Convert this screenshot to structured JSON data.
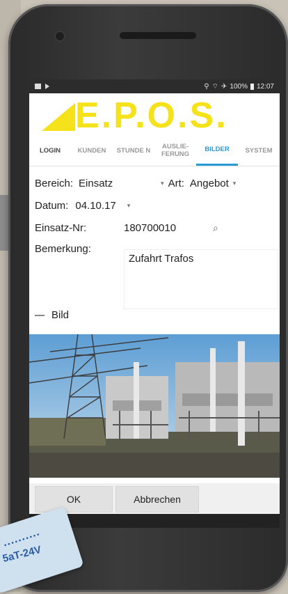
{
  "status_bar": {
    "right_text": "100%",
    "time": "12:07"
  },
  "logo": {
    "text": "E.P.O.S."
  },
  "tabs": [
    {
      "label": "LOGIN",
      "state": "dark"
    },
    {
      "label": "KUNDEN",
      "state": "inactive"
    },
    {
      "label": "STUNDE N",
      "state": "inactive"
    },
    {
      "label": "AUSLIE-FERUNG",
      "state": "inactive"
    },
    {
      "label": "BILDER",
      "state": "active"
    },
    {
      "label": "SYSTEM",
      "state": "inactive"
    }
  ],
  "form": {
    "bereich_label": "Bereich:",
    "bereich_value": "Einsatz",
    "art_label": "Art:",
    "art_value": "Angebot",
    "datum_label": "Datum:",
    "datum_value": "04.10.17",
    "einsatz_label": "Einsatz-Nr:",
    "einsatz_value": "180700010",
    "bemerkung_label": "Bemerkung:",
    "bemerkung_value": "Zufahrt Trafos"
  },
  "bild_label": "Bild",
  "buttons": {
    "ok": "OK",
    "cancel": "Abbrechen"
  },
  "card_text": "5aT-24V",
  "colors": {
    "logo_yellow": "#f5e21a",
    "active_tab": "#2a9ad6"
  }
}
